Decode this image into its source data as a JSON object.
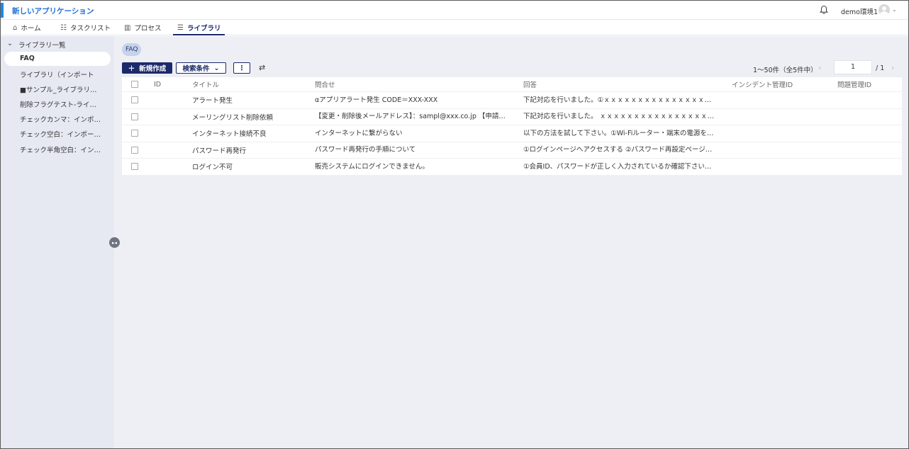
{
  "header": {
    "app_title": "新しいアプリケーション",
    "user_name": "demo環境1",
    "accent_color": "#1e88e5"
  },
  "nav": {
    "tabs": [
      {
        "label": "ホーム",
        "icon": "home-icon"
      },
      {
        "label": "タスクリスト",
        "icon": "checklist-icon"
      },
      {
        "label": "プロセス",
        "icon": "process-icon"
      },
      {
        "label": "ライブラリ",
        "icon": "list-icon",
        "active": true
      }
    ]
  },
  "sidebar": {
    "tree_label": "ライブラリ一覧",
    "items": [
      {
        "label": "FAQ",
        "selected": true
      },
      {
        "label": "ライブラリ（インポート"
      },
      {
        "label": "■サンプル_ライブラリ…"
      },
      {
        "label": "削除フラグテスト-ライ…"
      },
      {
        "label": "チェックカンマ：インポ…"
      },
      {
        "label": "チェック空白：インポー…"
      },
      {
        "label": "チェック半角空白：イン…"
      }
    ]
  },
  "main": {
    "chip": "FAQ",
    "new_button": "新規作成",
    "search_button": "検索条件",
    "more_button": "⋮",
    "range_text": "1〜50件（全5件中）",
    "page_value": "1",
    "page_total": "/ 1"
  },
  "table": {
    "columns": [
      "ID",
      "タイトル",
      "問合せ",
      "回答",
      "インシデント管理ID",
      "問題管理ID"
    ],
    "rows": [
      {
        "id": "",
        "title": "アラート発生",
        "question": "αアプリアラート発生 CODE＝XXX-XXX",
        "answer": "下記対応を行いました。①ｘｘｘｘｘｘｘｘｘｘｘｘｘｘｘｘｘ…",
        "incident": "",
        "problem": ""
      },
      {
        "id": "",
        "title": "メーリングリスト削除依頼",
        "question": "【変更・削除後メールアドレス】：sampl@xxx.co.jp 【申請理…",
        "answer": "下記対応を行いました。 ｘｘｘｘｘｘｘｘｘｘｘｘｘｘｘｘｘ…",
        "incident": "",
        "problem": ""
      },
      {
        "id": "",
        "title": "インターネット接続不良",
        "question": "インターネットに繋がらない",
        "answer": "以下の方法を試して下さい。①Wi-Fiルーター・端末の電源を…",
        "incident": "",
        "problem": ""
      },
      {
        "id": "",
        "title": "パスワード再発行",
        "question": "パスワード再発行の手順について",
        "answer": "①ログインページへアクセスする ②パスワード再設定ページへ…",
        "incident": "",
        "problem": ""
      },
      {
        "id": "",
        "title": "ログイン不可",
        "question": "販売システムにログインできません。",
        "answer": "①会員ID、パスワードが正しく入力されているか確認下さい。…",
        "incident": "",
        "problem": ""
      }
    ]
  }
}
